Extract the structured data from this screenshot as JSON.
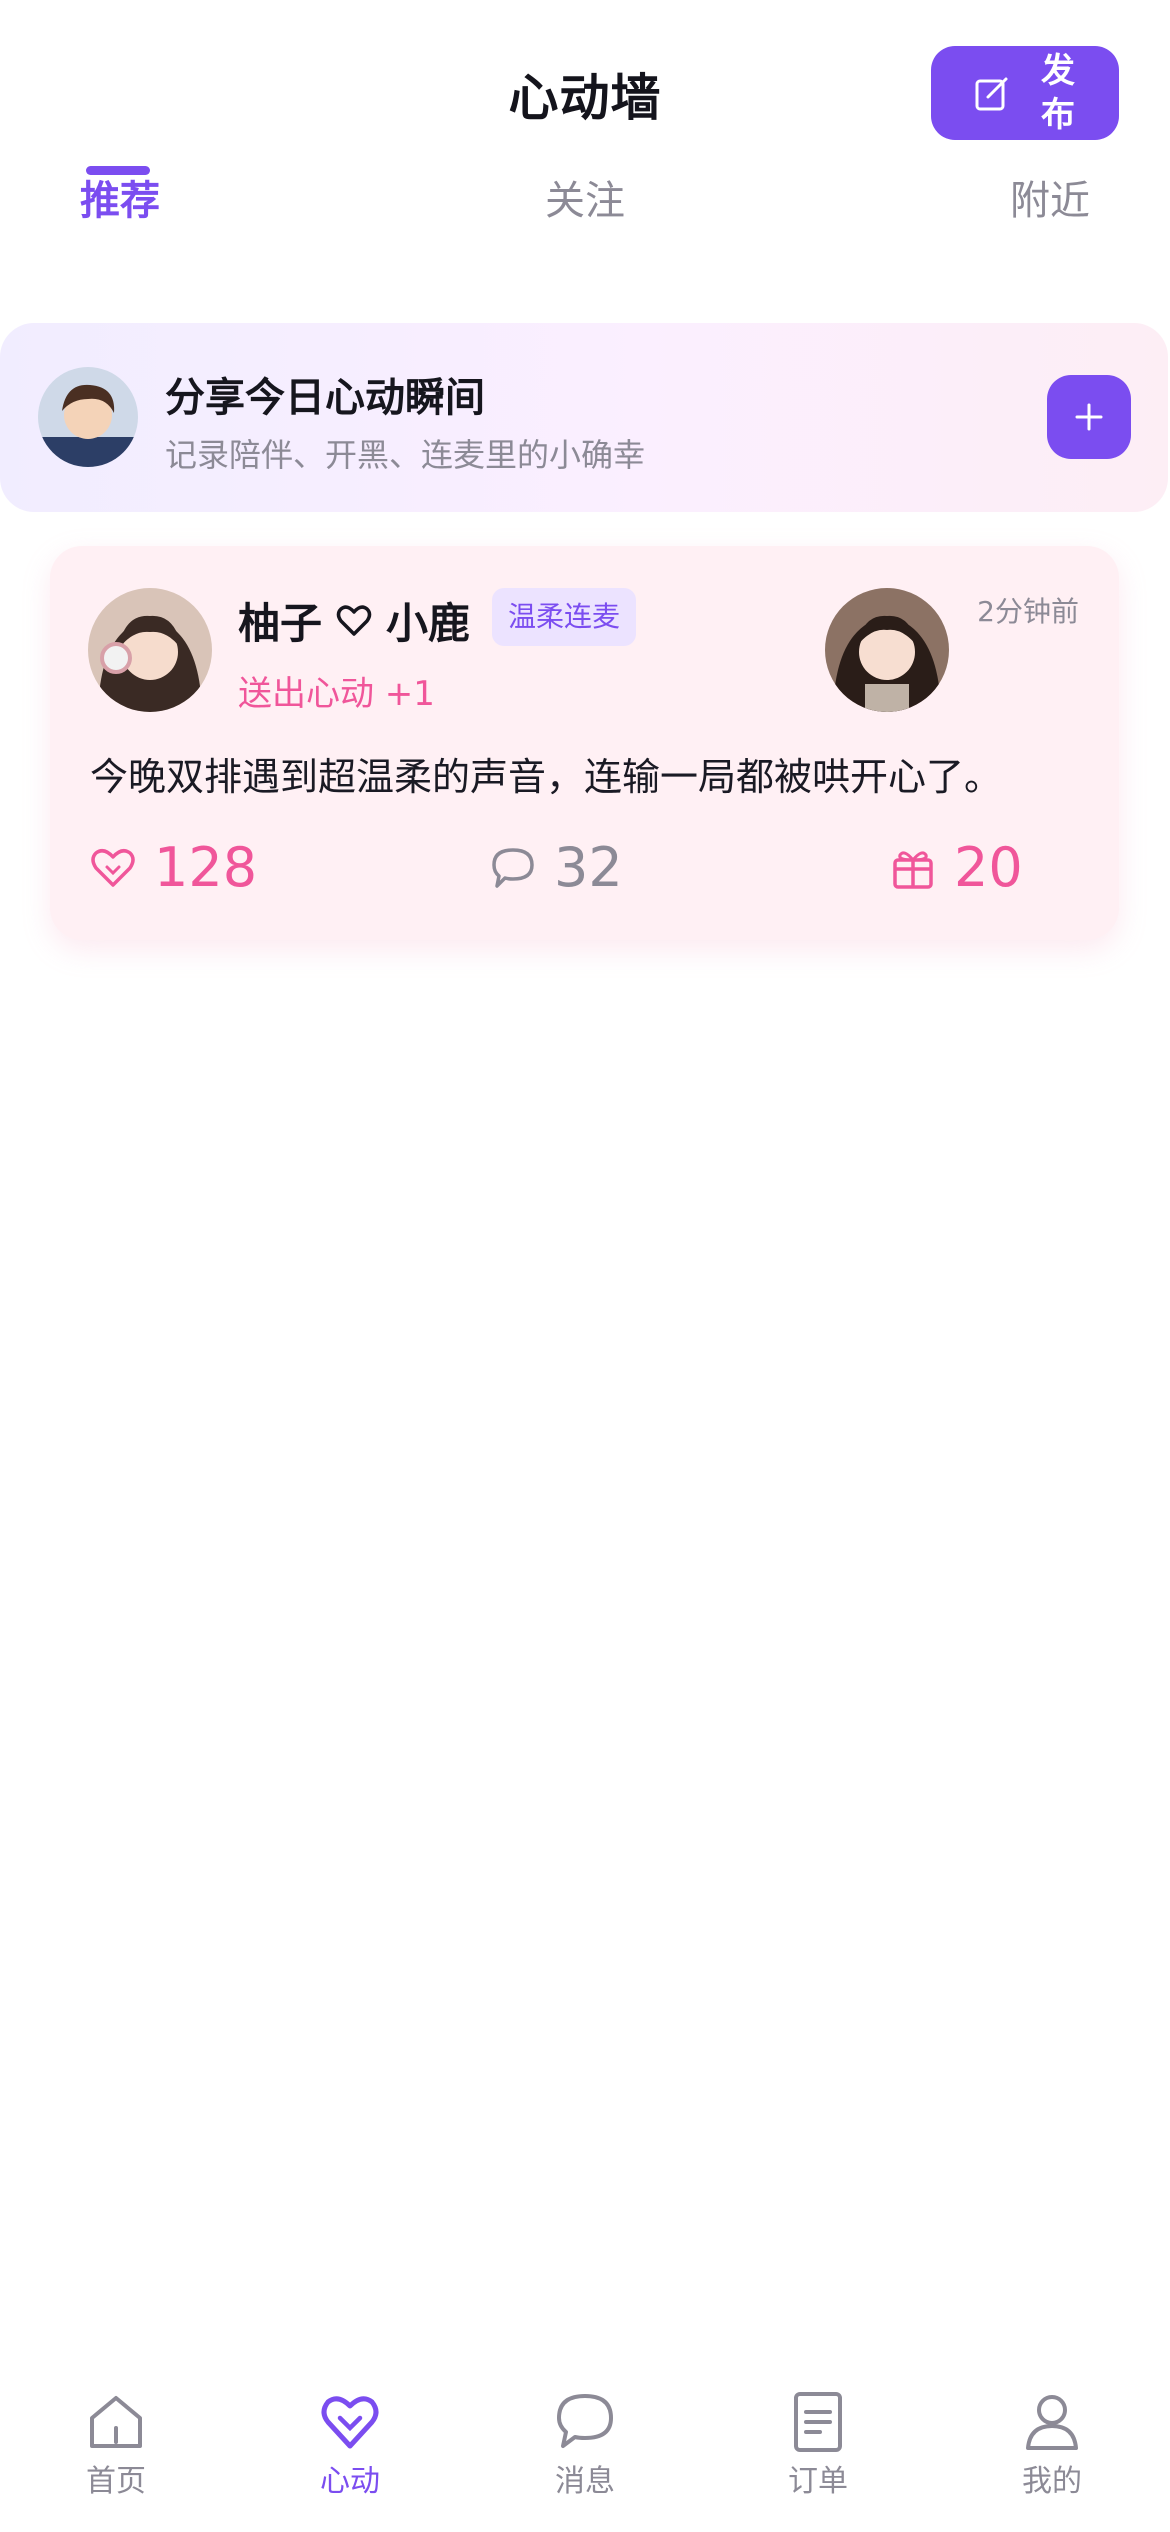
{
  "header": {
    "title": "心动墙",
    "publish_label": "发布"
  },
  "tabs": [
    {
      "label": "推荐",
      "active": true
    },
    {
      "label": "关注",
      "active": false
    },
    {
      "label": "附近",
      "active": false
    }
  ],
  "share_banner": {
    "title": "分享今日心动瞬间",
    "subtitle": "记录陪伴、开黑、连麦里的小确幸",
    "add_icon": "plus-icon"
  },
  "posts": [
    {
      "user_a": "柚子",
      "user_b": "小鹿",
      "tag": "温柔连麦",
      "time": "2分钟前",
      "action": "送出心动 +1",
      "content": "今晚双排遇到超温柔的声音，连输一局都被哄开心了。",
      "likes": "128",
      "comments": "32",
      "gifts": "20"
    }
  ],
  "bottom_nav": [
    {
      "label": "首页",
      "icon": "home-icon",
      "active": false
    },
    {
      "label": "心动",
      "icon": "heart-icon",
      "active": true
    },
    {
      "label": "消息",
      "icon": "message-icon",
      "active": false
    },
    {
      "label": "订单",
      "icon": "order-icon",
      "active": false
    },
    {
      "label": "我的",
      "icon": "profile-icon",
      "active": false
    }
  ],
  "colors": {
    "accent": "#7b4df0",
    "pink": "#f0569a",
    "muted": "#8c8a96",
    "card_bg": "#fff0f4"
  }
}
